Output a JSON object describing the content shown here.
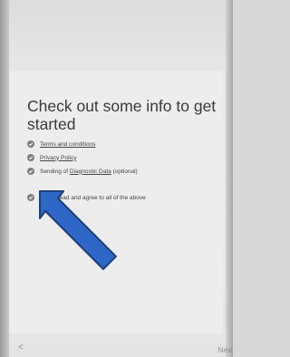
{
  "title": "Check out some info to get started",
  "items": [
    {
      "prefix": "",
      "link": "Terms and conditions",
      "suffix": ""
    },
    {
      "prefix": "",
      "link": "Privacy Policy",
      "suffix": ""
    },
    {
      "prefix": "Sending of ",
      "link": "Diagnostic Data",
      "suffix": " (optional)"
    }
  ],
  "agree_all": {
    "label": "I have read and agree to all of the above",
    "checked": true
  },
  "nav": {
    "back_label": "<",
    "next_label": "Next"
  },
  "colors": {
    "check": "#7e7e7e",
    "arrow_fill": "#2f67c6",
    "arrow_stroke": "#1e3f7a"
  }
}
